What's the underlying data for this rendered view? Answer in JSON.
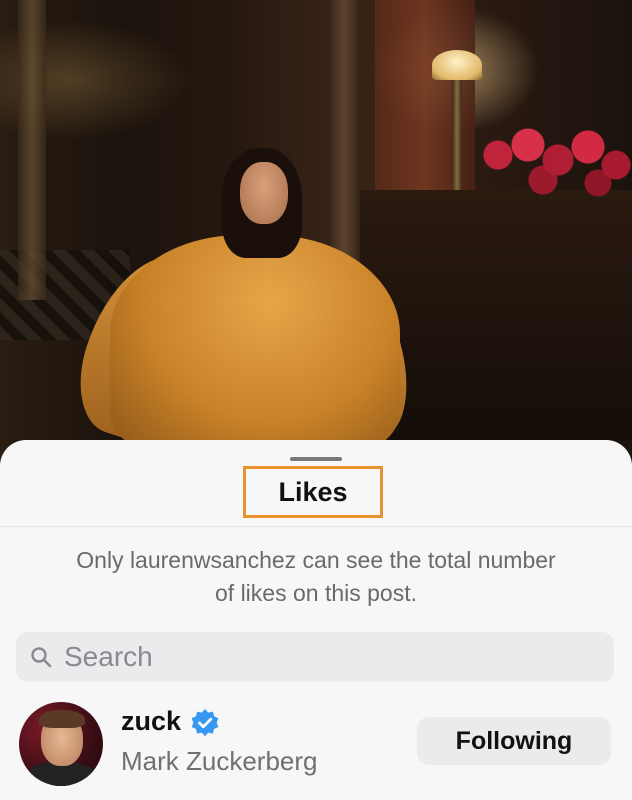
{
  "sheet": {
    "title": "Likes",
    "note": "Only laurenwsanchez can see the total number of likes on this post."
  },
  "search": {
    "placeholder": "Search",
    "icon": "search-icon"
  },
  "likers": [
    {
      "username": "zuck",
      "full_name": "Mark Zuckerberg",
      "verified": true,
      "button_label": "Following"
    }
  ],
  "colors": {
    "highlight": "#e8912d",
    "verified_badge": "#3897f0"
  }
}
